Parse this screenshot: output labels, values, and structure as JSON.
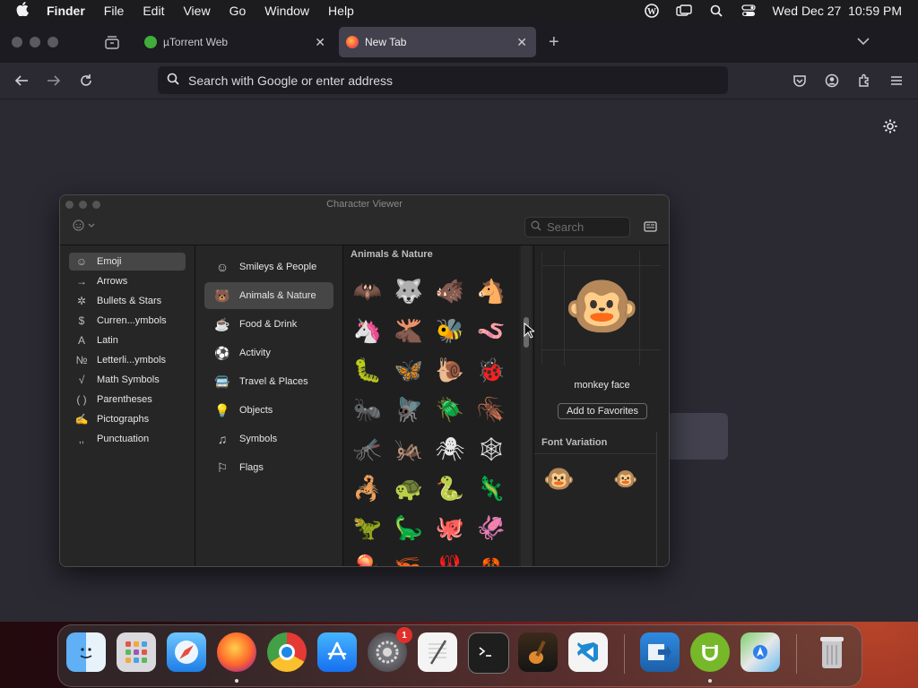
{
  "menubar": {
    "app_name": "Finder",
    "items": [
      "File",
      "Edit",
      "View",
      "Go",
      "Window",
      "Help"
    ],
    "clock": "Wed Dec 27  10:59 PM"
  },
  "browser": {
    "tabs": [
      {
        "title": "µTorrent Web",
        "active": false
      },
      {
        "title": "New Tab",
        "active": true
      }
    ],
    "url_placeholder": "Search with Google or enter address"
  },
  "character_viewer": {
    "title": "Character Viewer",
    "search_placeholder": "Search",
    "categories": [
      {
        "label": "Emoji",
        "icon": "☺"
      },
      {
        "label": "Arrows",
        "icon": "→"
      },
      {
        "label": "Bullets & Stars",
        "icon": "✲"
      },
      {
        "label": "Curren...ymbols",
        "icon": "$"
      },
      {
        "label": "Latin",
        "icon": "A"
      },
      {
        "label": "Letterli...ymbols",
        "icon": "№"
      },
      {
        "label": "Math Symbols",
        "icon": "√"
      },
      {
        "label": "Parentheses",
        "icon": "( )"
      },
      {
        "label": "Pictographs",
        "icon": "✍"
      },
      {
        "label": "Punctuation",
        "icon": "‚,"
      }
    ],
    "emoji_groups": [
      {
        "label": "Smileys & People",
        "icon": "☺"
      },
      {
        "label": "Animals & Nature",
        "icon": "🐻"
      },
      {
        "label": "Food & Drink",
        "icon": "☕"
      },
      {
        "label": "Activity",
        "icon": "⚽"
      },
      {
        "label": "Travel & Places",
        "icon": "🚍"
      },
      {
        "label": "Objects",
        "icon": "💡"
      },
      {
        "label": "Symbols",
        "icon": "♫"
      },
      {
        "label": "Flags",
        "icon": "⚐"
      }
    ],
    "section_title": "Animals & Nature",
    "glyph_rows": [
      [
        "🦇",
        "🐺",
        "🐗",
        "🐴"
      ],
      [
        "🦄",
        "🫎",
        "🐝",
        "🪱"
      ],
      [
        "🐛",
        "🦋",
        "🐌",
        "🐞"
      ],
      [
        "🐜",
        "🪰",
        "🪲",
        "🪳"
      ],
      [
        "🦟",
        "🦗",
        "🕷",
        "🕸"
      ],
      [
        "🦂",
        "🐢",
        "🐍",
        "🦎"
      ],
      [
        "🦖",
        "🦕",
        "🐙",
        "🦑"
      ],
      [
        "🪼",
        "🦐",
        "🦞",
        "🦀"
      ]
    ],
    "selected_glyph": "🐵",
    "selected_name": "monkey face",
    "add_favorites_label": "Add to Favorites",
    "font_variation_title": "Font Variation",
    "variations": [
      "🐵",
      "🐵"
    ]
  },
  "dock": {
    "apps": [
      "Finder",
      "Launchpad",
      "Safari",
      "Firefox",
      "Chrome",
      "App Store",
      "System Settings",
      "TextEdit",
      "Terminal",
      "GarageBand",
      "VS Code",
      "Migration Assistant",
      "µTorrent",
      "Maps",
      "Trash"
    ],
    "settings_badge": "1"
  }
}
